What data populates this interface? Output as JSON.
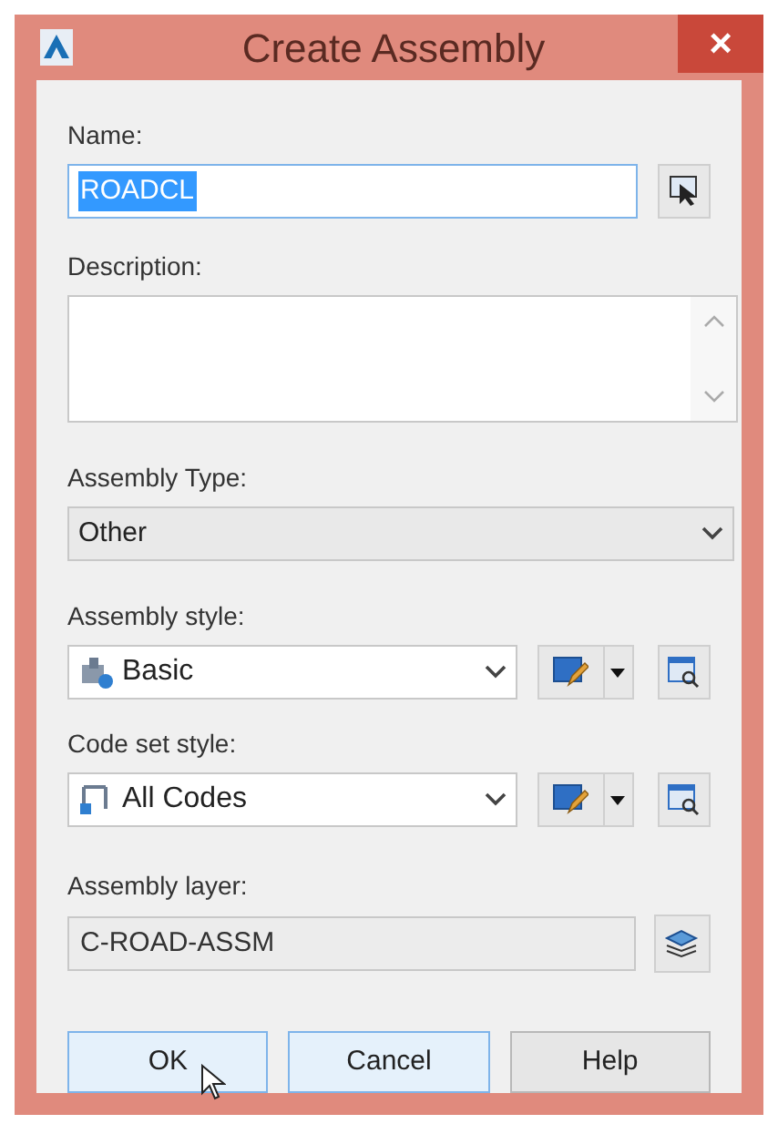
{
  "window": {
    "title": "Create Assembly",
    "close": "×"
  },
  "name": {
    "label": "Name:",
    "value": "ROADCL",
    "selected": true
  },
  "description": {
    "label": "Description:"
  },
  "assembly_type": {
    "label": "Assembly Type:",
    "value": "Other"
  },
  "assembly_style": {
    "label": "Assembly style:",
    "value": "Basic"
  },
  "code_set_style": {
    "label": "Code set style:",
    "value": "All Codes"
  },
  "assembly_layer": {
    "label": "Assembly layer:",
    "value": "C-ROAD-ASSM"
  },
  "buttons": [
    {
      "label": "OK",
      "highlighted": true
    },
    {
      "label": "Cancel",
      "highlighted": true
    },
    {
      "label": "Help",
      "highlighted": false
    }
  ]
}
